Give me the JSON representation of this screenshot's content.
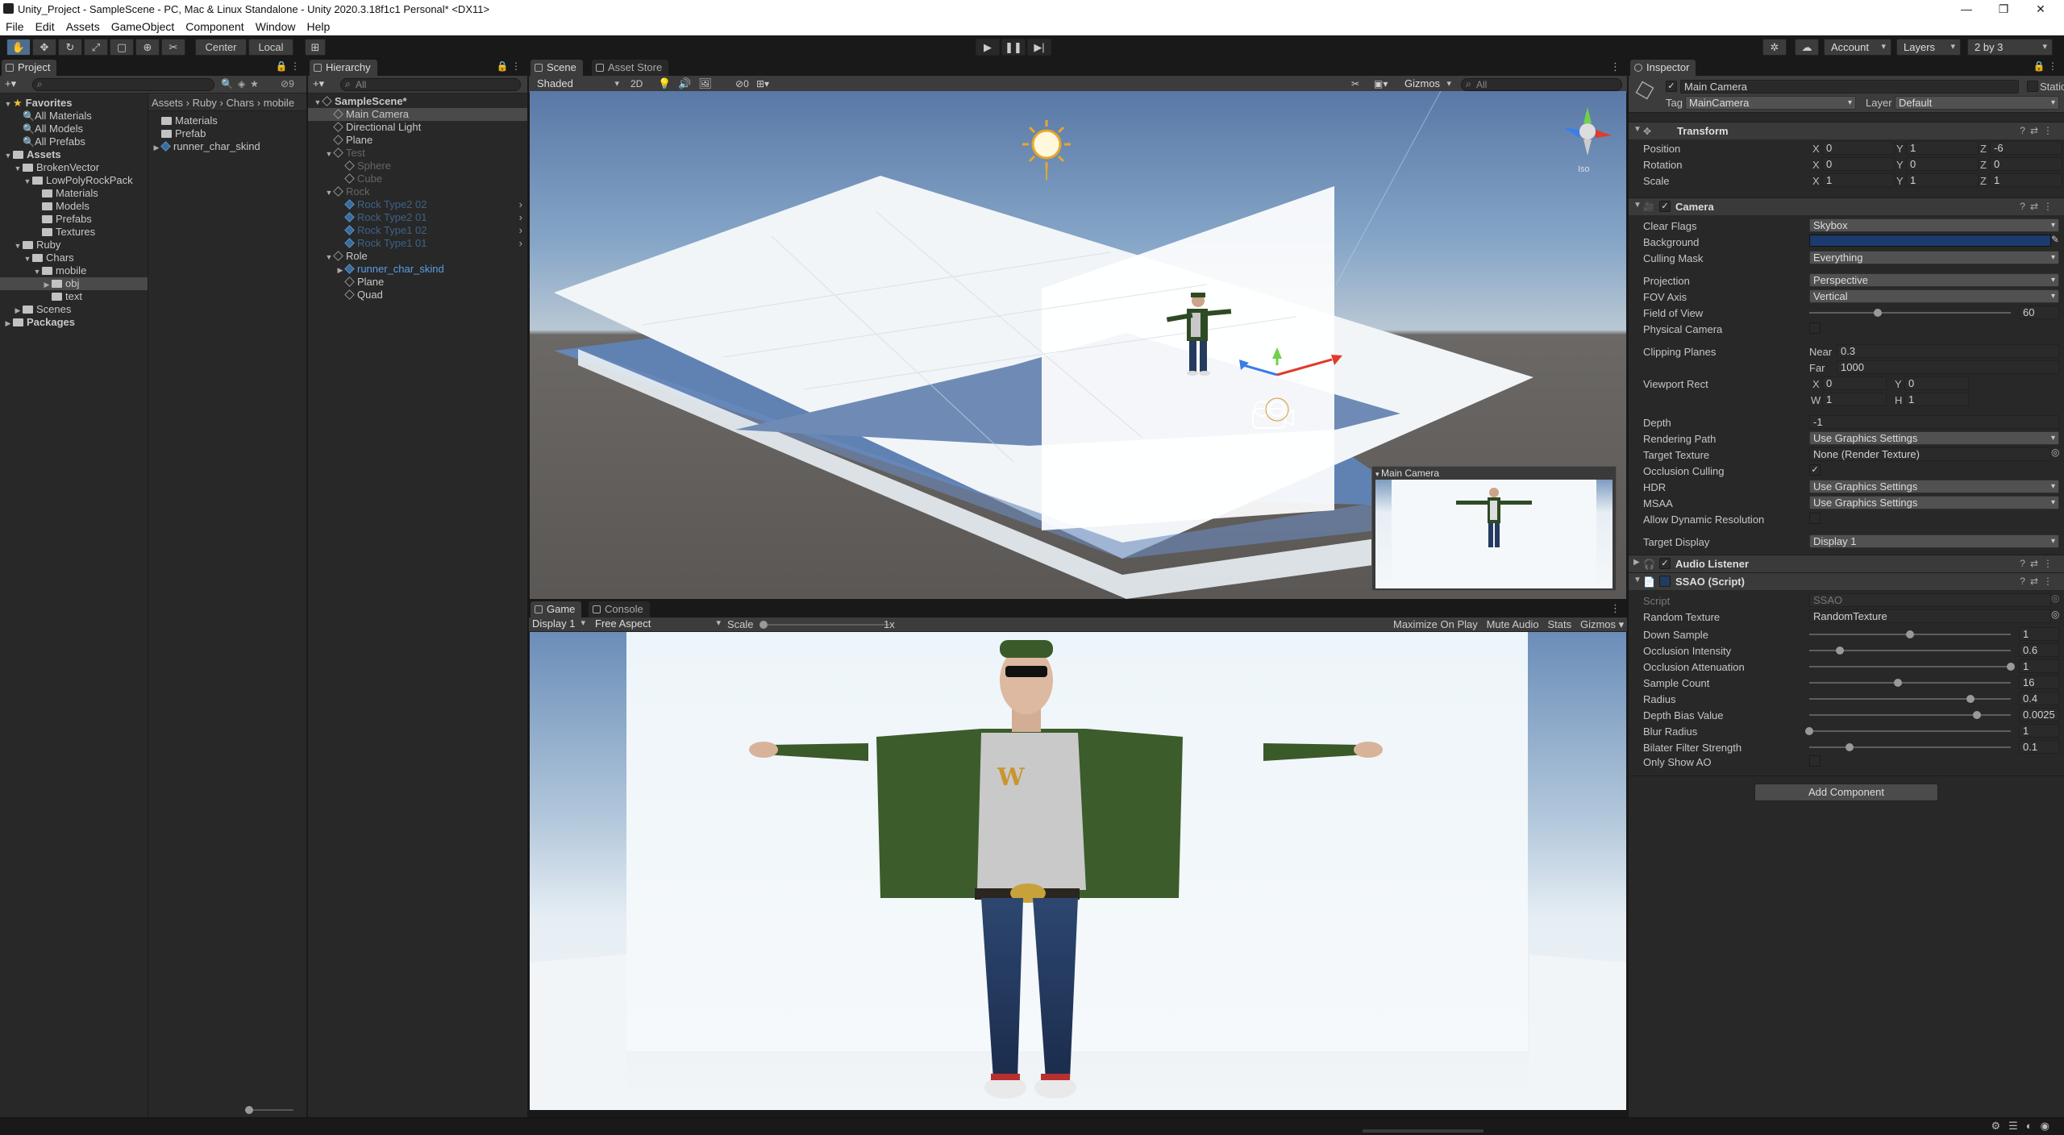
{
  "window": {
    "title": "Unity_Project - SampleScene - PC, Mac & Linux Standalone - Unity 2020.3.18f1c1 Personal* <DX11>",
    "controls": [
      "—",
      "❐",
      "✕"
    ]
  },
  "menu": [
    "File",
    "Edit",
    "Assets",
    "GameObject",
    "Component",
    "Window",
    "Help"
  ],
  "toolbar": {
    "pivot": "Center",
    "space": "Local",
    "account": "Account",
    "layers": "Layers",
    "layout": "2 by 3"
  },
  "project": {
    "tab": "Project",
    "breadcrumb": [
      "Assets",
      "Ruby",
      "Chars",
      "mobile"
    ],
    "hidden_count": "9",
    "tree": [
      {
        "label": "Favorites",
        "depth": 0,
        "kind": "star",
        "bold": true
      },
      {
        "label": "All Materials",
        "depth": 2,
        "kind": "search"
      },
      {
        "label": "All Models",
        "depth": 2,
        "kind": "search"
      },
      {
        "label": "All Prefabs",
        "depth": 2,
        "kind": "search"
      },
      {
        "label": "Assets",
        "depth": 0,
        "kind": "folder",
        "bold": true
      },
      {
        "label": "BrokenVector",
        "depth": 1,
        "kind": "folder"
      },
      {
        "label": "LowPolyRockPack",
        "depth": 2,
        "kind": "folder"
      },
      {
        "label": "Materials",
        "depth": 3,
        "kind": "folder"
      },
      {
        "label": "Models",
        "depth": 3,
        "kind": "folder"
      },
      {
        "label": "Prefabs",
        "depth": 3,
        "kind": "folder"
      },
      {
        "label": "Textures",
        "depth": 3,
        "kind": "folder"
      },
      {
        "label": "Ruby",
        "depth": 1,
        "kind": "folder"
      },
      {
        "label": "Chars",
        "depth": 2,
        "kind": "folder"
      },
      {
        "label": "mobile",
        "depth": 3,
        "kind": "folder"
      },
      {
        "label": "obj",
        "depth": 4,
        "kind": "folder",
        "selected": true
      },
      {
        "label": "text",
        "depth": 4,
        "kind": "folder"
      },
      {
        "label": "Scenes",
        "depth": 1,
        "kind": "folder"
      },
      {
        "label": "Packages",
        "depth": 0,
        "kind": "folder",
        "bold": true
      }
    ],
    "files": [
      "Materials",
      "Prefab",
      "runner_char_skind"
    ]
  },
  "hierarchy": {
    "tab": "Hierarchy",
    "search_placeholder": "All",
    "items": [
      {
        "label": "SampleScene*",
        "depth": 0,
        "style": "bold"
      },
      {
        "label": "Main Camera",
        "depth": 1,
        "style": "selected"
      },
      {
        "label": "Directional Light",
        "depth": 1,
        "style": "normal"
      },
      {
        "label": "Plane",
        "depth": 1,
        "style": "normal"
      },
      {
        "label": "Test",
        "depth": 1,
        "style": "dim"
      },
      {
        "label": "Sphere",
        "depth": 2,
        "style": "dim"
      },
      {
        "label": "Cube",
        "depth": 2,
        "style": "dim"
      },
      {
        "label": "Rock",
        "depth": 1,
        "style": "dim"
      },
      {
        "label": "Rock Type2 02",
        "depth": 2,
        "style": "dimblue"
      },
      {
        "label": "Rock Type2 01",
        "depth": 2,
        "style": "dimblue"
      },
      {
        "label": "Rock Type1 02",
        "depth": 2,
        "style": "dimblue"
      },
      {
        "label": "Rock Type1 01",
        "depth": 2,
        "style": "dimblue"
      },
      {
        "label": "Role",
        "depth": 1,
        "style": "normal"
      },
      {
        "label": "runner_char_skind",
        "depth": 2,
        "style": "blue"
      },
      {
        "label": "Plane",
        "depth": 2,
        "style": "normal"
      },
      {
        "label": "Quad",
        "depth": 2,
        "style": "normal"
      }
    ]
  },
  "scene": {
    "tabs": [
      "Scene",
      "Asset Store"
    ],
    "shading": "Shaded",
    "mode_2d": "2D",
    "fx_count": "0",
    "gizmos": "Gizmos",
    "search_placeholder": "All",
    "persp_label": "Iso",
    "camera_preview_title": "Main Camera"
  },
  "game": {
    "tabs": [
      "Game",
      "Console"
    ],
    "display": "Display 1",
    "aspect": "Free Aspect",
    "scale_label": "Scale",
    "scale_value": "1x",
    "options": [
      "Maximize On Play",
      "Mute Audio",
      "Stats",
      "Gizmos"
    ]
  },
  "inspector": {
    "tab": "Inspector",
    "object_name": "Main Camera",
    "static_label": "Static",
    "tag_label": "Tag",
    "tag": "MainCamera",
    "layer_label": "Layer",
    "layer": "Default",
    "transform": {
      "title": "Transform",
      "position": {
        "label": "Position",
        "x": "0",
        "y": "1",
        "z": "-6"
      },
      "rotation": {
        "label": "Rotation",
        "x": "0",
        "y": "0",
        "z": "0"
      },
      "scale": {
        "label": "Scale",
        "x": "1",
        "y": "1",
        "z": "1"
      }
    },
    "camera": {
      "title": "Camera",
      "clear_flags_label": "Clear Flags",
      "clear_flags": "Skybox",
      "background_label": "Background",
      "background_color": "#1b3b6e",
      "culling_mask_label": "Culling Mask",
      "culling_mask": "Everything",
      "projection_label": "Projection",
      "projection": "Perspective",
      "fov_axis_label": "FOV Axis",
      "fov_axis": "Vertical",
      "fov_label": "Field of View",
      "fov": "60",
      "fov_fraction": 0.34,
      "physical_label": "Physical Camera",
      "clipping_label": "Clipping Planes",
      "near_label": "Near",
      "near": "0.3",
      "far_label": "Far",
      "far": "1000",
      "viewport_label": "Viewport Rect",
      "vx": "0",
      "vy": "0",
      "vw": "1",
      "vh": "1",
      "depth_label": "Depth",
      "depth": "-1",
      "rendering_path_label": "Rendering Path",
      "rendering_path": "Use Graphics Settings",
      "target_texture_label": "Target Texture",
      "target_texture": "None (Render Texture)",
      "occlusion_label": "Occlusion Culling",
      "hdr_label": "HDR",
      "hdr": "Use Graphics Settings",
      "msaa_label": "MSAA",
      "msaa": "Use Graphics Settings",
      "dynres_label": "Allow Dynamic Resolution",
      "target_display_label": "Target Display",
      "target_display": "Display 1"
    },
    "audio_listener": {
      "title": "Audio Listener"
    },
    "ssao": {
      "title": "SSAO (Script)",
      "script_label": "Script",
      "script": "SSAO",
      "random_texture_label": "Random Texture",
      "random_texture": "RandomTexture",
      "params": [
        {
          "label": "Down Sample",
          "value": "1",
          "fraction": 0.5
        },
        {
          "label": "Occlusion Intensity",
          "value": "0.6",
          "fraction": 0.15
        },
        {
          "label": "Occlusion Attenuation",
          "value": "1",
          "fraction": 1.0
        },
        {
          "label": "Sample Count",
          "value": "16",
          "fraction": 0.44
        },
        {
          "label": "Radius",
          "value": "0.4",
          "fraction": 0.8
        },
        {
          "label": "Depth Bias Value",
          "value": "0.0025",
          "fraction": 0.83
        },
        {
          "label": "Blur Radius",
          "value": "1",
          "fraction": 0.0
        },
        {
          "label": "Bilater Filter Strength",
          "value": "0.1",
          "fraction": 0.2
        }
      ],
      "only_show_ao_label": "Only Show AO"
    },
    "add_component": "Add Component"
  }
}
